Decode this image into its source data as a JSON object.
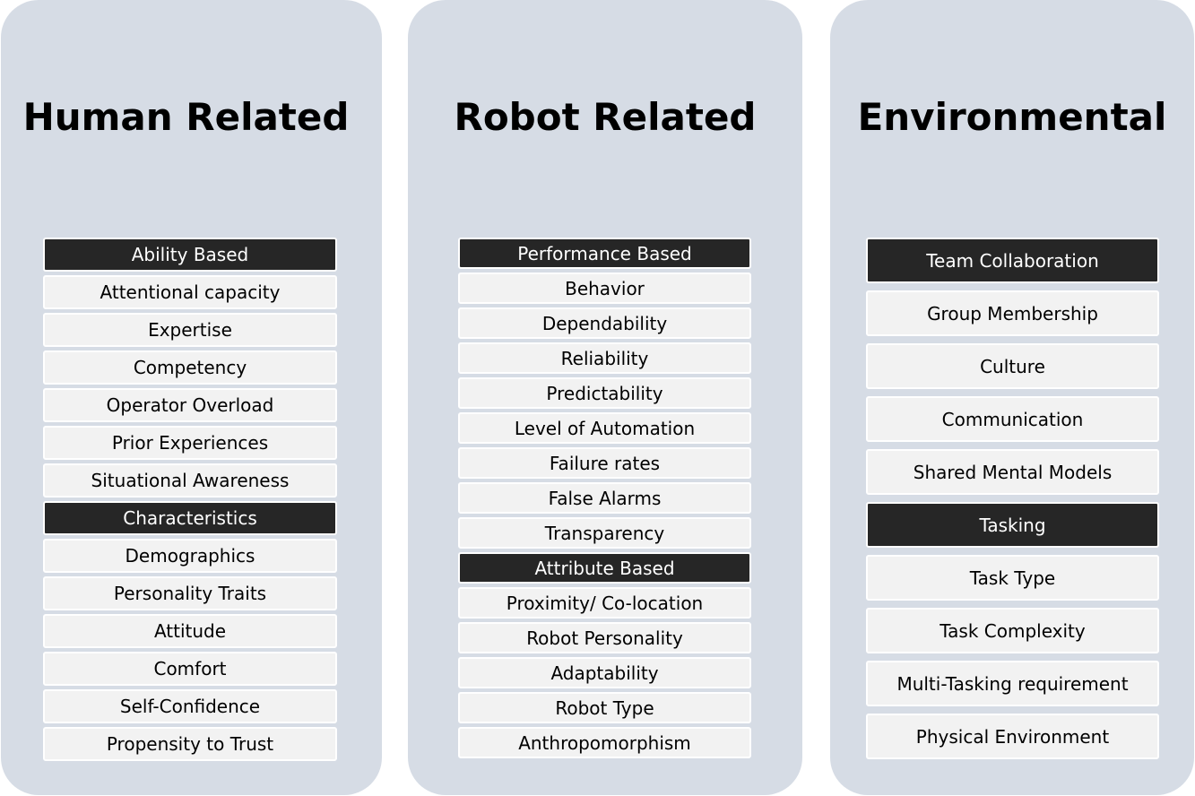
{
  "columns": [
    {
      "title": "Human Related",
      "groups": [
        {
          "header": "Ability Based",
          "items": [
            "Attentional capacity",
            "Expertise",
            "Competency",
            "Operator Overload",
            "Prior Experiences",
            "Situational Awareness"
          ]
        },
        {
          "header": "Characteristics",
          "items": [
            "Demographics",
            "Personality Traits",
            "Attitude",
            "Comfort",
            "Self-Confidence",
            "Propensity to Trust"
          ]
        }
      ]
    },
    {
      "title": "Robot Related",
      "groups": [
        {
          "header": "Performance Based",
          "items": [
            "Behavior",
            "Dependability",
            "Reliability",
            "Predictability",
            "Level of Automation",
            "Failure rates",
            "False Alarms",
            "Transparency"
          ]
        },
        {
          "header": "Attribute Based",
          "items": [
            "Proximity/ Co-location",
            "Robot Personality",
            "Adaptability",
            "Robot Type",
            "Anthropomorphism"
          ]
        }
      ]
    },
    {
      "title": "Environmental",
      "groups": [
        {
          "header": "Team Collaboration",
          "items": [
            "Group Membership",
            "Culture",
            "Communication",
            "Shared Mental Models"
          ]
        },
        {
          "header": "Tasking",
          "items": [
            "Task Type",
            "Task Complexity",
            "Multi-Tasking requirement",
            "Physical Environment"
          ]
        }
      ]
    }
  ]
}
